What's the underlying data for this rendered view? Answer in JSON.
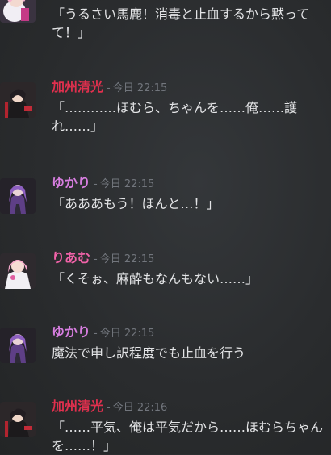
{
  "messages": [
    {
      "author": "",
      "time": "",
      "text": "「うるさい馬鹿！消毒と止血するから黙ってて！」",
      "color": "#ffffff",
      "avatar": "girl-white-icon"
    },
    {
      "author": "加州清光",
      "time": "今日 22:15",
      "text": "「…………ほむら、ちゃんを……俺……護れ……」",
      "color": "#e0304e",
      "avatar": "kashu-red-icon"
    },
    {
      "author": "ゆかり",
      "time": "今日 22:15",
      "text": "「あああもう！ほんと…！」",
      "color": "#d77ee0",
      "avatar": "yukari-purple-icon"
    },
    {
      "author": "りあむ",
      "time": "今日 22:15",
      "text": "「くそぉ、麻酔もなんもない……」",
      "color": "#f062a8",
      "avatar": "riamu-pink-icon"
    },
    {
      "author": "ゆかり",
      "time": "今日 22:15",
      "text": "魔法で申し訳程度でも止血を行う",
      "color": "#d77ee0",
      "avatar": "yukari-purple-icon"
    },
    {
      "author": "加州清光",
      "time": "今日 22:16",
      "text": "「……平気、俺は平気だから……ほむらちゃんを……！」",
      "color": "#e0304e",
      "avatar": "kashu-red-icon"
    }
  ],
  "separator": "-"
}
